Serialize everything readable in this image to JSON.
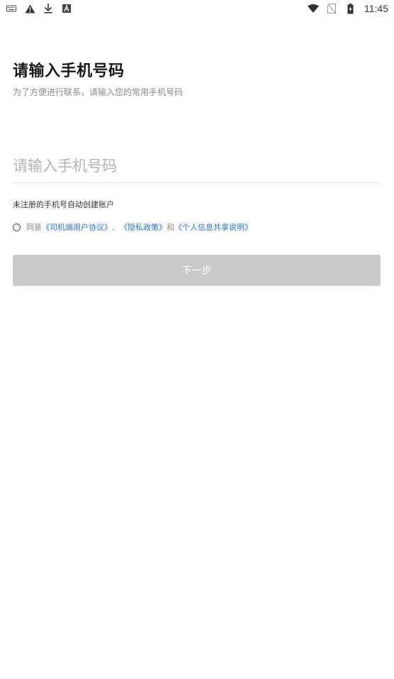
{
  "status_bar": {
    "time": "11:45",
    "left_icons": [
      "keyboard-icon",
      "warning-icon",
      "download-icon",
      "app-a-icon"
    ],
    "right_icons": [
      "wifi-icon",
      "no-sim-icon",
      "battery-icon"
    ]
  },
  "login": {
    "title": "请输入手机号码",
    "subtitle": "为了方便进行联系，请输入您的常用手机号码",
    "phone_placeholder": "请输入手机号码",
    "phone_value": "",
    "auto_register_hint": "未注册的手机号自动创建账户",
    "agreement": {
      "prefix": "同意",
      "link_driver_agreement": "《司机端用户协议》",
      "separator": "、",
      "link_privacy_policy": "《隐私政策》",
      "conjunction": "和",
      "link_personal_info": "《个人信息共享说明》",
      "checked": false
    },
    "next_button_label": "下一步"
  },
  "colors": {
    "link": "#2f6fcf",
    "button_disabled": "#c9cacc",
    "text_primary": "#1a1a1a",
    "text_secondary": "#8a8a8a"
  }
}
